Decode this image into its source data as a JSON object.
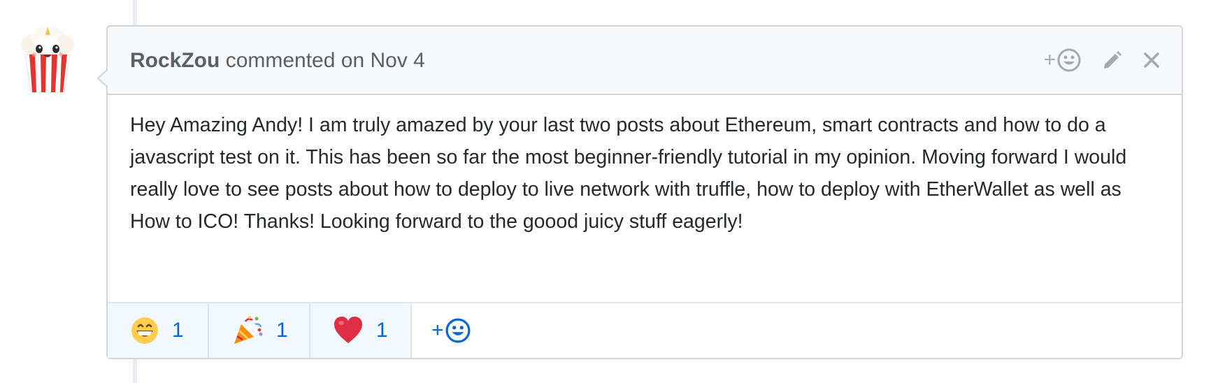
{
  "comment": {
    "author": "RockZou",
    "meta": "commented on Nov 4",
    "body": "Hey Amazing Andy! I am truly amazed by your last two posts about Ethereum, smart contracts and how to do a javascript test on it. This has been so far the most beginner-friendly tutorial in my opinion. Moving forward I would really love to see posts about how to deploy to live network with truffle, how to deploy with EtherWallet as well as How to ICO! Thanks! Looking forward to the goood juicy stuff eagerly!",
    "header_add_reaction_label": "+",
    "reactions": [
      {
        "icon": "grinning-face-emoji",
        "count": "1"
      },
      {
        "icon": "party-popper-emoji",
        "count": "1"
      },
      {
        "icon": "red-heart-emoji",
        "count": "1"
      }
    ],
    "footer_add_reaction_label": "+"
  },
  "colors": {
    "header_bg": "#f6f8fa",
    "border": "#d1d5da",
    "reaction_bg": "#f1f8ff",
    "link_blue": "#0366d6",
    "text": "#24292e",
    "muted": "#586069"
  },
  "icons": {
    "avatar": "popcorn-avatar",
    "header_actions": [
      "add-reaction-icon",
      "pencil-icon",
      "close-icon"
    ]
  }
}
